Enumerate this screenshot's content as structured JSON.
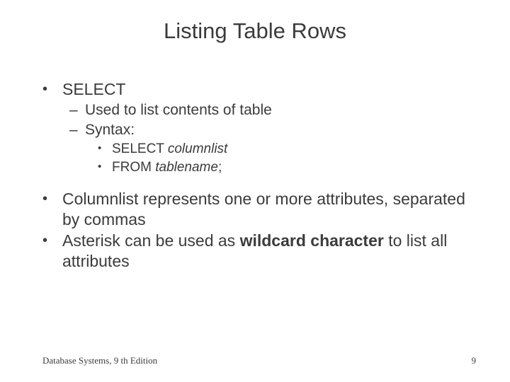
{
  "title": "Listing Table Rows",
  "bullets": {
    "b1": "SELECT",
    "b1_sub1": "Used to list contents of table",
    "b1_sub2": "Syntax:",
    "b1_sub2_s1_pre": "SELECT ",
    "b1_sub2_s1_it": "columnlist",
    "b1_sub2_s2_pre": "FROM ",
    "b1_sub2_s2_it": "tablename",
    "b1_sub2_s2_post": ";",
    "b2": "Columnlist represents one or more attributes, separated by commas",
    "b3_pre": "Asterisk can be used as ",
    "b3_bold": "wildcard character",
    "b3_post": " to list all attributes"
  },
  "footer": {
    "left": "Database Systems, 9 th Edition",
    "right": "9"
  }
}
